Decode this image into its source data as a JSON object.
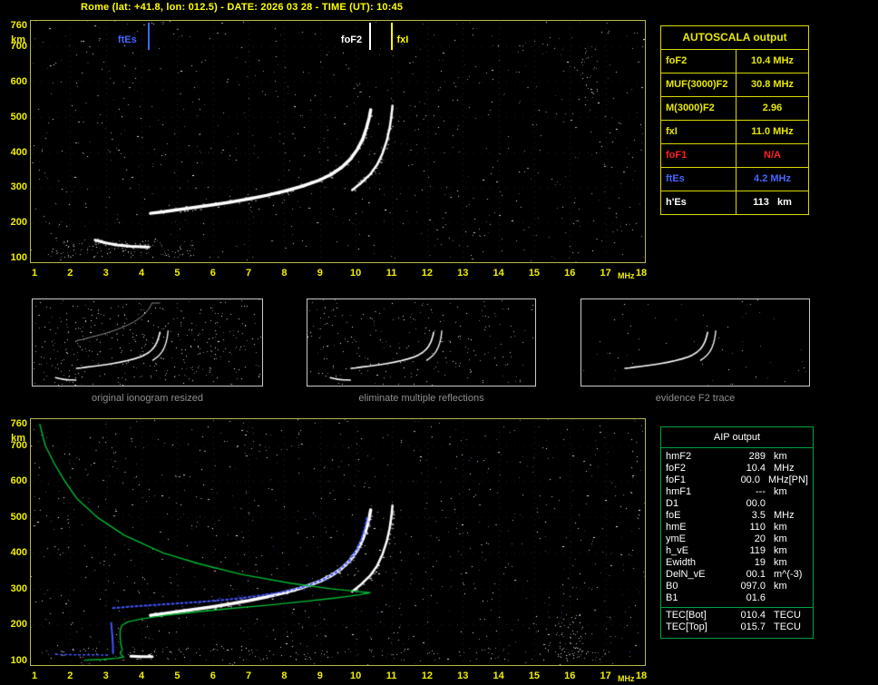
{
  "header": {
    "title": "Rome (lat: +41.8, lon: 012.5) - DATE: 2026 03 28 - TIME (UT): 10:45"
  },
  "colors": {
    "background": "#000000",
    "axis_text": "#f0f000",
    "panel_border": "#b8b84a",
    "autoscala_border": "#d9d900",
    "aip_border": "#00a23c",
    "trace_white": "#ffffff",
    "trace_blue": "#4455ff",
    "profile_green": "#00bb33",
    "error_red": "#ff2222",
    "caption_gray": "#8f8f8f"
  },
  "autoscala_table": {
    "title": "AUTOSCALA output",
    "rows": [
      {
        "label": "foF2",
        "value": "10.4 MHz",
        "color": "#e8e800"
      },
      {
        "label": "MUF(3000)F2",
        "value": "30.8 MHz",
        "color": "#e8e800"
      },
      {
        "label": "M(3000)F2",
        "value": "2.96",
        "color": "#e8e800"
      },
      {
        "label": "fxI",
        "value": "11.0 MHz",
        "color": "#e8e800"
      },
      {
        "label": "foF1",
        "value": "N/A",
        "color": "#ff2222"
      },
      {
        "label": "ftEs",
        "value": "4.2 MHz",
        "color": "#4466ff"
      },
      {
        "label": "h'Es",
        "value": "113   km",
        "color": "#ffffff"
      }
    ]
  },
  "aip_table": {
    "title": "AIP output",
    "rows": [
      {
        "label": "hmF2",
        "value": "289",
        "unit": "km",
        "note": ""
      },
      {
        "label": "foF2",
        "value": "10.4",
        "unit": "MHz",
        "note": ""
      },
      {
        "label": "foF1",
        "value": "00.0",
        "unit": "MHz",
        "note": "[PN]"
      },
      {
        "label": "hmF1",
        "value": "---",
        "unit": "km",
        "note": ""
      },
      {
        "label": "D1",
        "value": "00.0",
        "unit": "",
        "note": ""
      },
      {
        "label": "foE",
        "value": "3.5",
        "unit": "MHz",
        "note": ""
      },
      {
        "label": "hmE",
        "value": "110",
        "unit": "km",
        "note": ""
      },
      {
        "label": "ymE",
        "value": "20",
        "unit": "km",
        "note": ""
      },
      {
        "label": "h_vE",
        "value": "119",
        "unit": "km",
        "note": ""
      },
      {
        "label": "Ewidth",
        "value": "19",
        "unit": "km",
        "note": ""
      },
      {
        "label": "DelN_vE",
        "value": "00.1",
        "unit": "m^(-3)",
        "note": ""
      },
      {
        "label": "B0",
        "value": "097.0",
        "unit": "km",
        "note": ""
      },
      {
        "label": "B1",
        "value": "01.6",
        "unit": "",
        "note": ""
      }
    ],
    "tec_rows": [
      {
        "label": "TEC[Bot]",
        "value": "010.4",
        "unit": "TECU"
      },
      {
        "label": "TEC[Top]",
        "value": "015.7",
        "unit": "TECU"
      }
    ]
  },
  "thumbnails": [
    {
      "caption": "original ionogram resized"
    },
    {
      "caption": "eliminate multiple reflections"
    },
    {
      "caption": "evidence F2 trace"
    }
  ],
  "chart_data": [
    {
      "type": "scatter",
      "xlabel": "MHz",
      "ylabel": "km",
      "xlim": [
        1,
        18
      ],
      "ylim": [
        100,
        760
      ],
      "x_ticks": [
        1,
        2,
        3,
        4,
        5,
        6,
        7,
        8,
        9,
        10,
        11,
        12,
        13,
        14,
        15,
        16,
        17,
        18
      ],
      "y_ticks": [
        760,
        700,
        600,
        500,
        400,
        300,
        200,
        100
      ],
      "grid": "dotted",
      "markers": [
        {
          "label": "ftEs",
          "freq": 4.2,
          "color": "#4466ff",
          "label_offset": -34
        },
        {
          "label": "foF2",
          "freq": 10.4,
          "color": "#ffffff",
          "label_offset": -32
        },
        {
          "label": "fxI",
          "freq": 11.0,
          "color": "#ffff00",
          "label_offset": 6
        }
      ],
      "series": [
        {
          "name": "F2 O-mode trace",
          "color": "#ffffff",
          "width": 3.5,
          "speckle": 90,
          "points": [
            [
              4.25,
              226
            ],
            [
              4.6,
              230
            ],
            [
              5.0,
              236
            ],
            [
              5.5,
              243
            ],
            [
              6.0,
              250
            ],
            [
              6.5,
              258
            ],
            [
              7.0,
              267
            ],
            [
              7.5,
              277
            ],
            [
              8.0,
              289
            ],
            [
              8.5,
              303
            ],
            [
              9.0,
              321
            ],
            [
              9.3,
              336
            ],
            [
              9.6,
              356
            ],
            [
              9.85,
              380
            ],
            [
              10.05,
              408
            ],
            [
              10.2,
              438
            ],
            [
              10.3,
              468
            ],
            [
              10.38,
              498
            ],
            [
              10.42,
              520
            ]
          ]
        },
        {
          "name": "F2 X-mode trace",
          "color": "#ffffff",
          "width": 2.5,
          "speckle": 40,
          "points": [
            [
              9.9,
              292
            ],
            [
              10.15,
              312
            ],
            [
              10.4,
              336
            ],
            [
              10.6,
              364
            ],
            [
              10.75,
              396
            ],
            [
              10.87,
              432
            ],
            [
              10.95,
              468
            ],
            [
              11.0,
              502
            ],
            [
              11.03,
              532
            ]
          ]
        },
        {
          "name": "Es trace",
          "color": "#ffffff",
          "width": 3,
          "speckle": 25,
          "points": [
            [
              2.7,
              150
            ],
            [
              3.0,
              142
            ],
            [
              3.3,
              136
            ],
            [
              3.7,
              132
            ],
            [
              4.0,
              131
            ],
            [
              4.2,
              130
            ]
          ]
        }
      ]
    },
    {
      "type": "scatter",
      "xlabel": "MHz",
      "ylabel": "km",
      "xlim": [
        1,
        18
      ],
      "ylim": [
        100,
        760
      ],
      "x_ticks": [
        1,
        2,
        3,
        4,
        5,
        6,
        7,
        8,
        9,
        10,
        11,
        12,
        13,
        14,
        15,
        16,
        17,
        18
      ],
      "y_ticks": [
        760,
        700,
        600,
        500,
        400,
        300,
        200,
        100
      ],
      "grid": "dotted",
      "markers": [],
      "series": [
        {
          "name": "F2 O-mode trace",
          "color": "#ffffff",
          "width": 3.5,
          "speckle": 90,
          "points": [
            [
              4.25,
              226
            ],
            [
              4.6,
              230
            ],
            [
              5.0,
              236
            ],
            [
              5.5,
              243
            ],
            [
              6.0,
              250
            ],
            [
              6.5,
              258
            ],
            [
              7.0,
              267
            ],
            [
              7.5,
              277
            ],
            [
              8.0,
              289
            ],
            [
              8.5,
              303
            ],
            [
              9.0,
              321
            ],
            [
              9.3,
              336
            ],
            [
              9.6,
              356
            ],
            [
              9.85,
              380
            ],
            [
              10.05,
              408
            ],
            [
              10.2,
              438
            ],
            [
              10.3,
              468
            ],
            [
              10.38,
              498
            ],
            [
              10.42,
              520
            ]
          ]
        },
        {
          "name": "F2 X-mode trace",
          "color": "#ffffff",
          "width": 2.5,
          "speckle": 40,
          "points": [
            [
              9.9,
              292
            ],
            [
              10.15,
              312
            ],
            [
              10.4,
              336
            ],
            [
              10.6,
              364
            ],
            [
              10.75,
              396
            ],
            [
              10.87,
              432
            ],
            [
              10.95,
              468
            ],
            [
              11.0,
              502
            ],
            [
              11.03,
              532
            ]
          ]
        },
        {
          "name": "Es trace",
          "color": "#ffffff",
          "width": 3,
          "speckle": 15,
          "points": [
            [
              3.7,
              112
            ],
            [
              4.0,
              111
            ],
            [
              4.3,
              111
            ]
          ]
        },
        {
          "name": "restored F2 trace",
          "color": "#4455ff",
          "width": 2,
          "dash": [
            2,
            3
          ],
          "speckle": 40,
          "points": [
            [
              3.2,
              246
            ],
            [
              3.8,
              251
            ],
            [
              4.4,
              255
            ],
            [
              5.0,
              259
            ],
            [
              5.6,
              263
            ],
            [
              6.2,
              268
            ],
            [
              6.8,
              274
            ],
            [
              7.4,
              282
            ],
            [
              8.0,
              292
            ],
            [
              8.6,
              307
            ],
            [
              9.1,
              326
            ],
            [
              9.5,
              349
            ],
            [
              9.8,
              376
            ],
            [
              10.0,
              404
            ],
            [
              10.15,
              436
            ],
            [
              10.25,
              468
            ],
            [
              10.32,
              500
            ]
          ]
        },
        {
          "name": "restored E trace",
          "color": "#4455ff",
          "width": 2,
          "points": [
            [
              3.15,
              205
            ],
            [
              3.18,
              170
            ],
            [
              3.2,
              140
            ],
            [
              3.2,
              120
            ]
          ]
        },
        {
          "name": "restored Es trace",
          "color": "#4455ff",
          "width": 1.5,
          "dash": [
            2,
            3
          ],
          "points": [
            [
              1.6,
              117
            ],
            [
              2.1,
              116
            ],
            [
              2.6,
              116
            ],
            [
              3.05,
              115
            ]
          ]
        },
        {
          "name": "electron density profile N(h)",
          "color": "#00bb33",
          "width": 1.4,
          "points": [
            [
              1.15,
              758
            ],
            [
              1.3,
              700
            ],
            [
              1.55,
              650
            ],
            [
              1.85,
              600
            ],
            [
              2.2,
              550
            ],
            [
              2.75,
              500
            ],
            [
              3.5,
              450
            ],
            [
              4.6,
              400
            ],
            [
              5.6,
              370
            ],
            [
              6.8,
              340
            ],
            [
              8.2,
              315
            ],
            [
              9.3,
              300
            ],
            [
              10.1,
              292
            ],
            [
              10.4,
              289
            ],
            [
              10.1,
              283
            ],
            [
              9.4,
              274
            ],
            [
              8.5,
              264
            ],
            [
              7.5,
              254
            ],
            [
              6.4,
              244
            ],
            [
              5.4,
              234
            ],
            [
              4.6,
              225
            ],
            [
              4.0,
              216
            ],
            [
              3.6,
              207
            ],
            [
              3.45,
              198
            ],
            [
              3.4,
              185
            ],
            [
              3.4,
              165
            ],
            [
              3.42,
              145
            ],
            [
              3.46,
              130
            ],
            [
              3.4,
              119
            ],
            [
              3.5,
              110
            ],
            [
              3.3,
              106
            ],
            [
              2.9,
              103
            ],
            [
              2.4,
              101
            ]
          ]
        }
      ]
    }
  ]
}
